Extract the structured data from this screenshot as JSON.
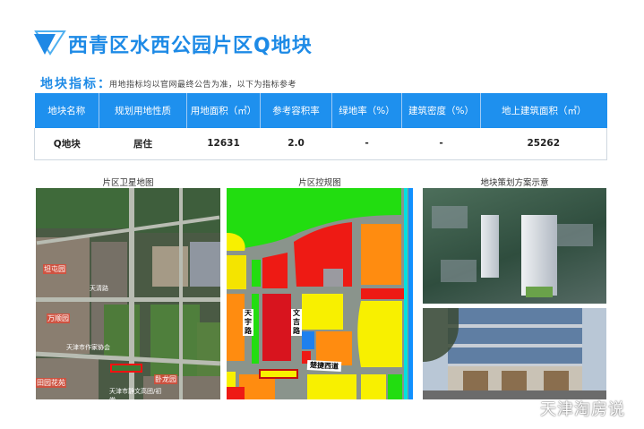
{
  "header": {
    "title": "西青区水西公园片区Q地块",
    "icon": "triangle-logo-icon"
  },
  "indicators": {
    "heading": "地块指标：",
    "note": "用地指标均以官网最终公告为准，以下为指标参考"
  },
  "table": {
    "columns": [
      "地块名称",
      "规划用地性质",
      "用地面积（㎡）",
      "参考容积率",
      "绿地率（%）",
      "建筑密度（%）",
      "地上建筑面积（㎡）"
    ],
    "rows": [
      [
        "Q地块",
        "居住",
        "12631",
        "2.0",
        "-",
        "-",
        "25262"
      ]
    ]
  },
  "images": {
    "satellite": {
      "caption": "片区卫星地图",
      "labels": [
        "天津市作家协会",
        "天津市静文高团/初学",
        "天清路",
        "坦屯园",
        "万顺园",
        "田园花苑",
        "卧龙园",
        "天清路"
      ]
    },
    "control": {
      "caption": "片区控规图",
      "labels": [
        "天宇路",
        "文吉路",
        "楚捷西道"
      ]
    },
    "rendering": {
      "caption": "地块策划方案示意"
    }
  },
  "watermark": "天津淘房说",
  "colors": {
    "accent": "#1e90ee",
    "title": "#1d8ae6"
  }
}
